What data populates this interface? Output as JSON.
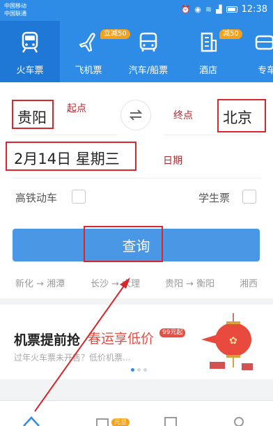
{
  "status": {
    "carrier_line1": "中国移动",
    "carrier_line2": "中国联通",
    "time": "12:38"
  },
  "tabs": [
    {
      "label": "火车票",
      "icon": "train-icon",
      "active": true
    },
    {
      "label": "飞机票",
      "icon": "plane-icon",
      "badge": "立减50"
    },
    {
      "label": "汽车/船票",
      "icon": "bus-icon"
    },
    {
      "label": "酒店",
      "icon": "hotel-icon",
      "badge": "减50"
    },
    {
      "label": "专车",
      "icon": "car-icon"
    }
  ],
  "search": {
    "from_station": "贵阳",
    "to_station": "北京",
    "from_annotation": "起点",
    "to_annotation": "终点",
    "date": "2月14日  星期三",
    "date_annotation": "日期",
    "swap_icon": "swap-icon",
    "option_highspeed": "高铁动车",
    "option_student": "学生票",
    "search_button": "查询"
  },
  "history": [
    "新化 → 湘潭",
    "长沙 → 大理",
    "贵阳 → 衡阳",
    "湘西"
  ],
  "promo": {
    "title": "机票提前抢",
    "highlight": "春运享低价",
    "badge": "99元起",
    "subtitle": "过年火车票未开售？低价机票..."
  },
  "bottom_nav": {
    "badge": "元旦"
  },
  "colors": {
    "brand_blue": "#2f8ce6",
    "button_blue": "#4a97e6",
    "annotation_red": "#d8262d",
    "badge_orange": "#f4a21c"
  }
}
